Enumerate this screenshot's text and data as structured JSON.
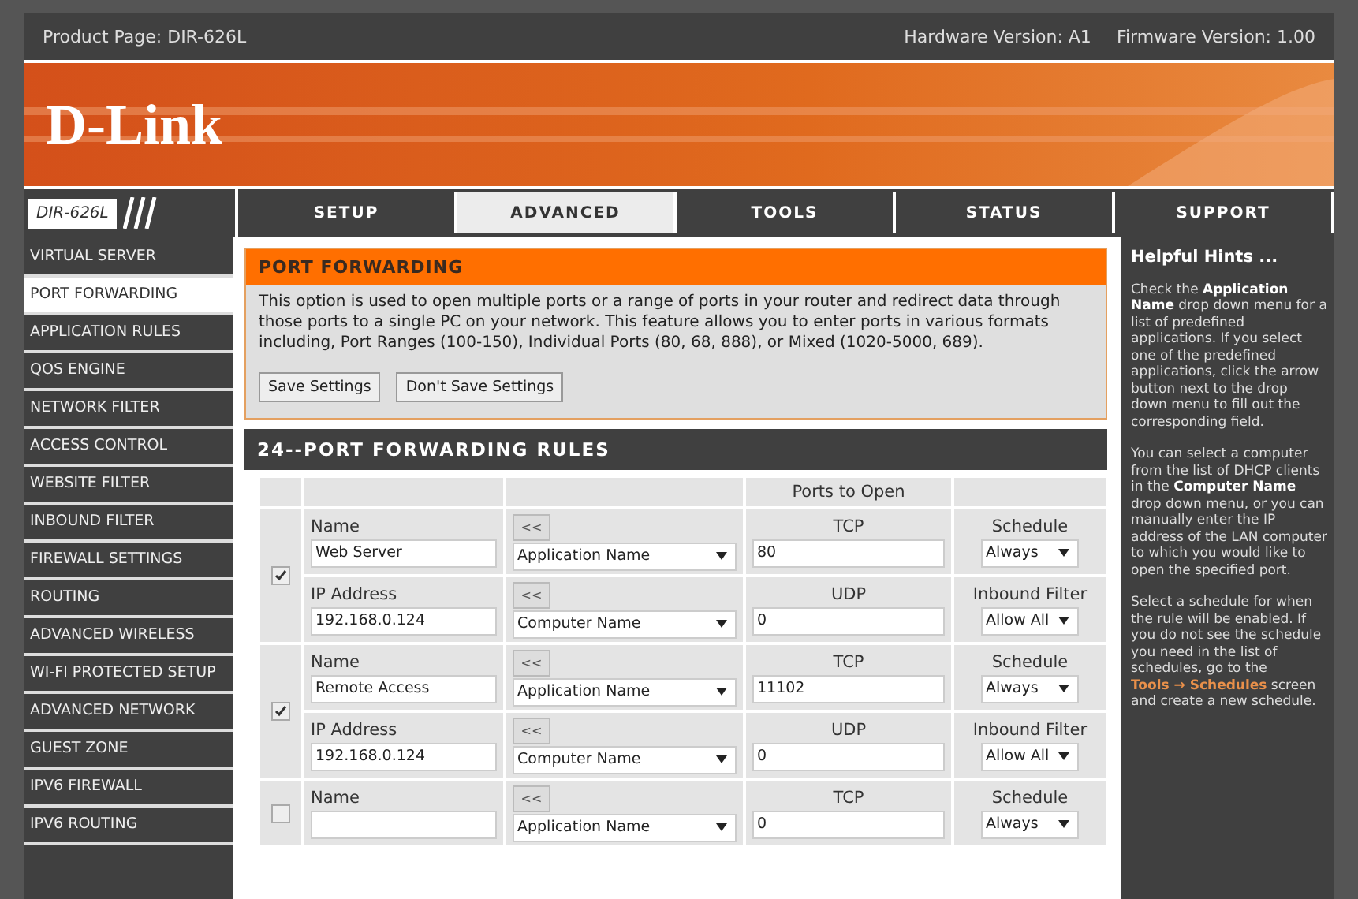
{
  "top_bar": {
    "product": "Product Page: DIR-626L",
    "hardware": "Hardware Version: A1",
    "firmware": "Firmware Version: 1.00"
  },
  "logo": "D-Link",
  "nav": {
    "model": "DIR-626L",
    "tabs": [
      {
        "label": "SETUP",
        "selected": false
      },
      {
        "label": "ADVANCED",
        "selected": true
      },
      {
        "label": "TOOLS",
        "selected": false
      },
      {
        "label": "STATUS",
        "selected": false
      },
      {
        "label": "SUPPORT",
        "selected": false
      }
    ]
  },
  "sidebar": {
    "items": [
      {
        "label": "VIRTUAL SERVER",
        "selected": false
      },
      {
        "label": "PORT FORWARDING",
        "selected": true
      },
      {
        "label": "APPLICATION RULES",
        "selected": false
      },
      {
        "label": "QOS ENGINE",
        "selected": false
      },
      {
        "label": "NETWORK FILTER",
        "selected": false
      },
      {
        "label": "ACCESS CONTROL",
        "selected": false
      },
      {
        "label": "WEBSITE FILTER",
        "selected": false
      },
      {
        "label": "INBOUND FILTER",
        "selected": false
      },
      {
        "label": "FIREWALL SETTINGS",
        "selected": false
      },
      {
        "label": "ROUTING",
        "selected": false
      },
      {
        "label": "ADVANCED WIRELESS",
        "selected": false
      },
      {
        "label": "WI-FI PROTECTED SETUP",
        "selected": false
      },
      {
        "label": "ADVANCED NETWORK",
        "selected": false
      },
      {
        "label": "GUEST ZONE",
        "selected": false
      },
      {
        "label": "IPV6 FIREWALL",
        "selected": false
      },
      {
        "label": "IPV6 ROUTING",
        "selected": false
      }
    ]
  },
  "port_forwarding": {
    "title": "PORT FORWARDING",
    "description": "This option is used to open multiple ports or a range of ports in your router and redirect data through those ports to a single PC on your network. This feature allows you to enter ports in various formats including, Port Ranges (100-150), Individual Ports (80, 68, 888), or Mixed (1020-5000, 689).",
    "buttons": [
      "Save Settings",
      "Don't Save Settings"
    ]
  },
  "rules": {
    "title": "24--PORT FORWARDING RULES",
    "ports_header": "Ports to Open",
    "items": [
      {
        "checked": true,
        "name_label": "Name",
        "name": "Web Server",
        "app_button": "<<",
        "app_select": "Application Name",
        "tcp_label": "TCP",
        "tcp": "80",
        "schedule_label": "Schedule",
        "schedule": "Always",
        "ip_label": "IP Address",
        "ip": "192.168.0.124",
        "computer_button": "<<",
        "computer_select": "Computer Name",
        "udp_label": "UDP",
        "udp": "0",
        "filter_label": "Inbound Filter",
        "filter": "Allow All"
      },
      {
        "checked": true,
        "name_label": "Name",
        "name": "Remote Access",
        "app_button": "<<",
        "app_select": "Application Name",
        "tcp_label": "TCP",
        "tcp": "11102",
        "schedule_label": "Schedule",
        "schedule": "Always",
        "ip_label": "IP Address",
        "ip": "192.168.0.124",
        "computer_button": "<<",
        "computer_select": "Computer Name",
        "udp_label": "UDP",
        "udp": "0",
        "filter_label": "Inbound Filter",
        "filter": "Allow All"
      },
      {
        "checked": false,
        "name_label": "Name",
        "app_button": "<<",
        "app_select": "Application Name",
        "tcp_label": "TCP",
        "tcp": "0",
        "schedule_label": "Schedule",
        "schedule": "Always"
      }
    ]
  },
  "hints": {
    "title": "Helpful Hints ...",
    "paragraphs": [
      {
        "text": "Check the **Application Name** drop down menu for a list of predefined applications. If you select one of the predefined applications, click the arrow button next to the drop down menu to fill out the corresponding field."
      },
      {
        "text": "You can select a computer from the list of DHCP clients in the **Computer Name** drop down menu, or you can manually enter the IP address of the LAN computer to which you would like to open the specified port."
      },
      {
        "text": "Select a schedule for when the rule will be enabled. If you do not see the schedule you need in the list of schedules, go to the",
        "link": "Tools → Schedules",
        "after": "screen and create a new schedule."
      }
    ]
  }
}
